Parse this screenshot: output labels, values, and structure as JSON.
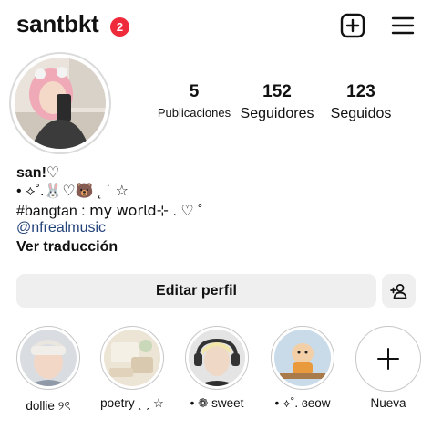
{
  "header": {
    "username": "santbkt",
    "notification_count": "2",
    "create_icon": "plus-square-icon",
    "menu_icon": "hamburger-menu-icon"
  },
  "profile": {
    "avatar_icon": "profile-photo",
    "stats": {
      "posts": {
        "value": "5",
        "label": "Publicaciones"
      },
      "followers": {
        "value": "152",
        "label": "Seguidores"
      },
      "following": {
        "value": "123",
        "label": "Seguidos"
      }
    }
  },
  "bio": {
    "name": "san!♡",
    "line1": "• ⟡˚.🐰♡🐻 ˛ ˙ ☆",
    "line2": "#bangtan : 𝗆𝗒 𝗐𝗈𝗋𝗅𝖽⊹ . ♡ ˚",
    "link": "@nfrealmusic",
    "translate": "Ver traducción"
  },
  "actions": {
    "edit_profile": "Editar perfil",
    "discover_people_icon": "add-person-icon"
  },
  "highlights": [
    {
      "label": "dollie ୨ৎ"
    },
    {
      "label": "poetry ˎ ˏ ☆"
    },
    {
      "label": "• ❁ sweet"
    },
    {
      "label": "• ⟡˚. ɞeow"
    },
    {
      "label": "Nueva"
    }
  ],
  "colors": {
    "badge": "#ef2b3b",
    "link": "#22437a",
    "button_bg": "#efefef"
  }
}
